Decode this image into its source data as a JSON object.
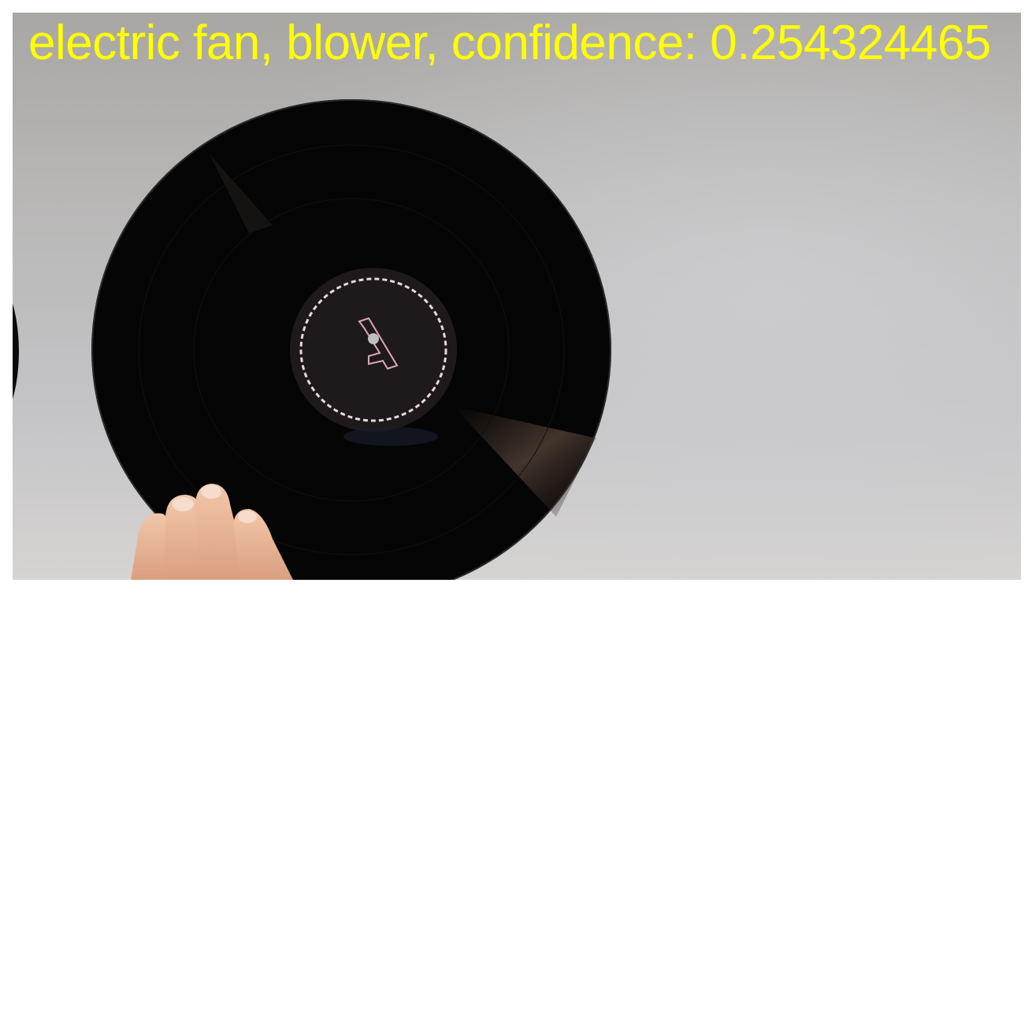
{
  "caption": {
    "label": "electric fan, blower",
    "confidence_label": "confidence:",
    "confidence_value": "0.254324465",
    "color": "#ffff00"
  },
  "photo": {
    "subject": "vinyl-record",
    "background_color": "#b8b7b6",
    "disc_color": "#050505",
    "label_color": "#1e1a1c"
  }
}
